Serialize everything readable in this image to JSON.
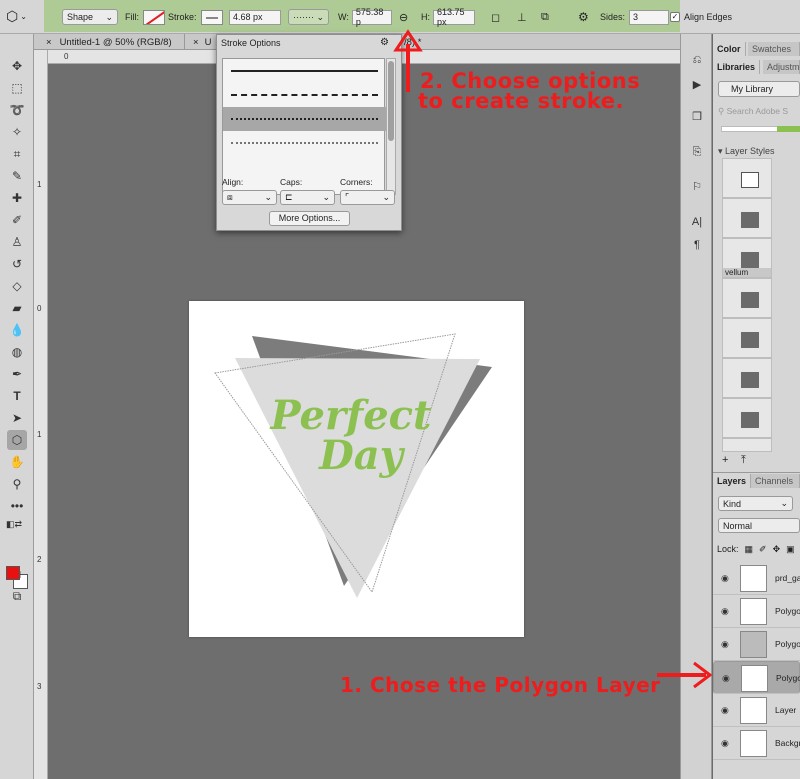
{
  "options_bar": {
    "mode": "Shape",
    "fill_label": "Fill:",
    "stroke_label": "Stroke:",
    "stroke_width": "4.68 px",
    "stroke_style": "·······",
    "w_label": "W:",
    "w_value": "575.38 p",
    "h_label": "H:",
    "h_value": "613.75 px",
    "sides_label": "Sides:",
    "sides_value": "3",
    "align_edges": "Align Edges",
    "align_checked": "✓"
  },
  "tabs": [
    {
      "label": "Untitled-1 @ 50% (RGB/8)",
      "close": "×"
    },
    {
      "label": "U",
      "close": "×"
    },
    {
      "label": "/8) *",
      "close": ""
    }
  ],
  "rulers": {
    "top": [
      "0"
    ],
    "left": [
      "1",
      "0",
      "1",
      "2",
      "3"
    ]
  },
  "stroke_popup": {
    "title": "Stroke Options",
    "align_label": "Align:",
    "caps_label": "Caps:",
    "corners_label": "Corners:",
    "more_options": "More Options..."
  },
  "artwork": {
    "line1": "Perfect",
    "line2": "Day",
    "text_color": "#8cc152"
  },
  "panels": {
    "top_tabs": [
      "Color",
      "Swatches"
    ],
    "lib_tabs": [
      "Libraries",
      "Adjustm"
    ],
    "library_select": "My Library",
    "search_placeholder": "Search Adobe S",
    "layer_styles_header": "Layer Styles",
    "vellum_label": "vellum",
    "layers_tabs": [
      "Layers",
      "Channels"
    ],
    "kind_select": "Kind",
    "blend_mode": "Normal",
    "lock_label": "Lock:",
    "layers": [
      {
        "name": "prd_ga",
        "selected": false
      },
      {
        "name": "Polygo",
        "selected": false
      },
      {
        "name": "Polygo",
        "selected": false
      },
      {
        "name": "Polygo",
        "selected": true
      },
      {
        "name": "Layer",
        "selected": false
      },
      {
        "name": "Backgr",
        "selected": false
      }
    ]
  },
  "annotations": {
    "step2_line1": "2. Choose options",
    "step2_line2": "to create stroke.",
    "step1": "1. Chose the Polygon Layer",
    "color": "#ee1c1c"
  },
  "colors": {
    "highlight": "#a8c98a",
    "foreground": "#e81010",
    "background": "#ffffff"
  }
}
